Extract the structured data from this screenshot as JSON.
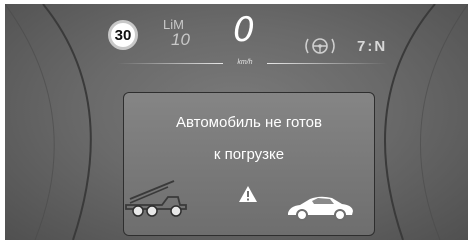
{
  "speed_limit_sign": "30",
  "limit_assist": {
    "label": "LiM",
    "value": "10"
  },
  "speed": {
    "value": "0",
    "unit": "km/h"
  },
  "right_status": "7:N",
  "message": {
    "line1": "Автомобиль не готов",
    "line2": "к погрузке"
  },
  "icons": [
    "tow-truck-icon",
    "warning-triangle-icon",
    "car-icon",
    "steering-assist-icon"
  ],
  "colors": {
    "text": "#ffffff",
    "panel": "#7a7a7a",
    "background": "#5e5e5e",
    "warning": "#ffffff"
  }
}
